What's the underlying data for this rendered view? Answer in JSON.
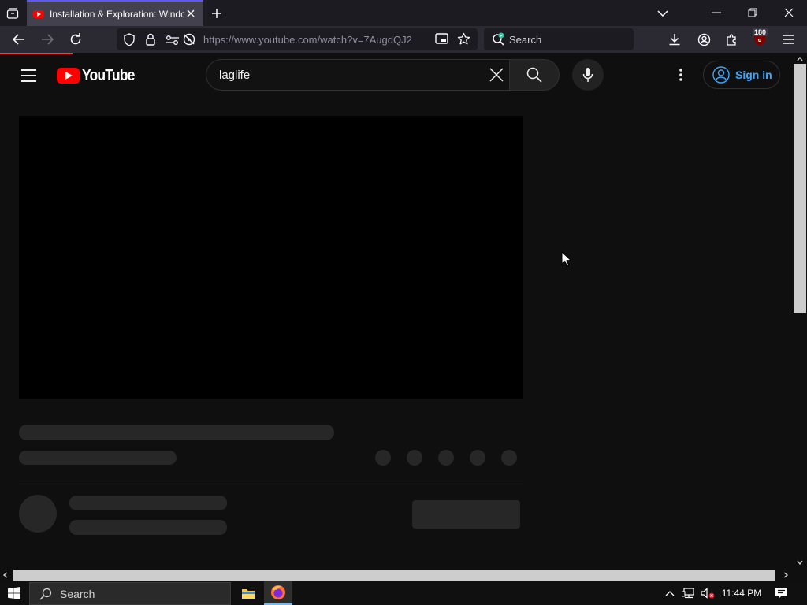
{
  "browser": {
    "tab": {
      "title": "Installation & Exploration: Windows",
      "favicon": "youtube-favicon"
    },
    "url": "https://www.youtube.com/watch?v=7AugdQJ2",
    "search_placeholder": "Search",
    "extension_badge": "180",
    "accent_color": "#5b5bf0"
  },
  "youtube": {
    "logo_text": "YouTube",
    "search_query": "laglife",
    "signin_label": "Sign in",
    "brand_color": "#ff0000",
    "link_color": "#3ea6ff"
  },
  "taskbar": {
    "search_label": "Search",
    "time": "11:44 PM",
    "pinned": [
      "file-explorer",
      "firefox"
    ]
  }
}
